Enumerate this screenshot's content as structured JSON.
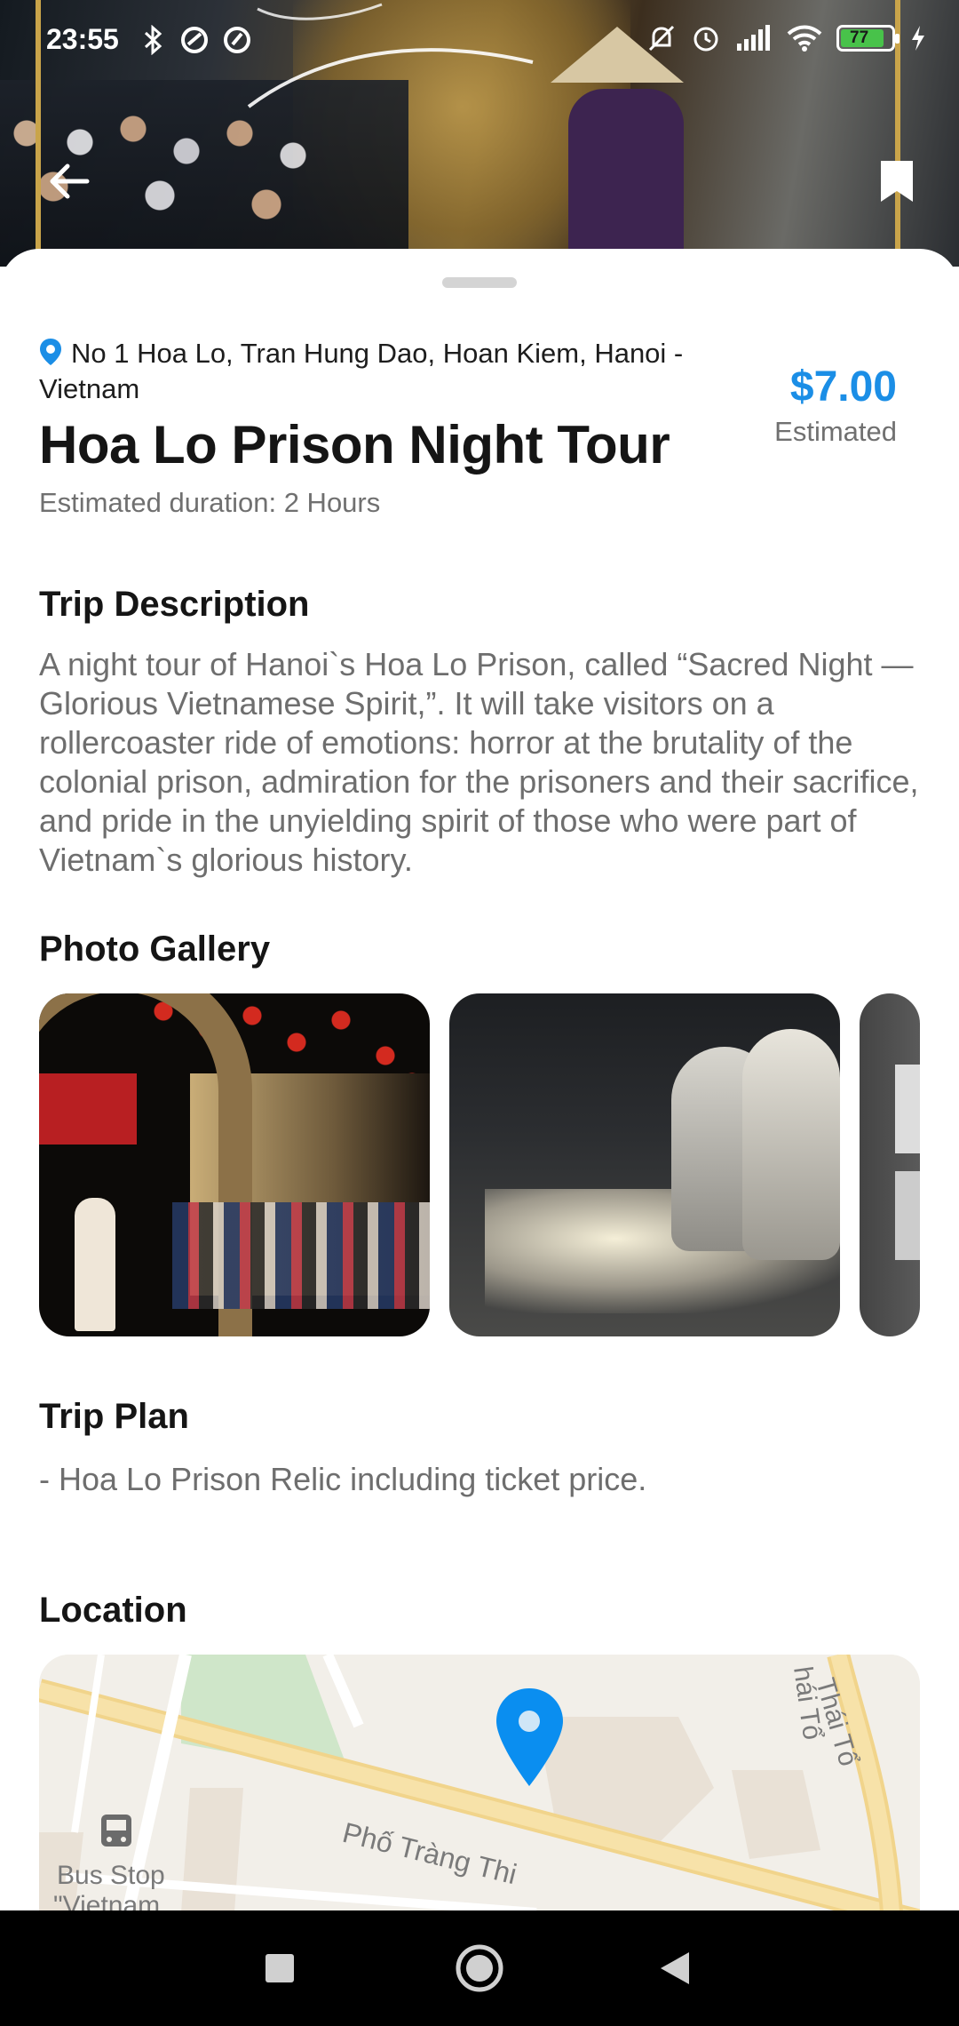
{
  "status_bar": {
    "time": "23:55",
    "battery": "77",
    "icons": [
      "bluetooth-icon",
      "app-icon",
      "app-icon",
      "mute-icon",
      "alarm-icon",
      "signal-icon",
      "wifi-icon",
      "battery-icon",
      "charging-icon"
    ]
  },
  "header": {
    "back_icon": "arrow-left-icon",
    "bookmark_icon": "bookmark-icon"
  },
  "tour": {
    "address": "No 1 Hoa Lo, Tran Hung Dao, Hoan Kiem, Hanoi - Vietnam",
    "title": "Hoa Lo Prison Night Tour",
    "duration": "Estimated duration: 2 Hours",
    "price": "$7.00",
    "price_note": "Estimated"
  },
  "description": {
    "heading": "Trip Description",
    "text": "A night tour of Hanoi`s Hoa Lo Prison, called “Sacred Night — Glorious Vietnamese Spirit,”. It will take visitors on a rollercoaster ride of emotions: horror at the brutality of the colonial prison, admiration for the prisoners and their sacrifice, and pride in the unyielding spirit of those who were part of Vietnam`s glorious history."
  },
  "gallery": {
    "heading": "Photo Gallery",
    "photo_count_visible": 3
  },
  "plan": {
    "heading": "Trip Plan",
    "text": "- Hoa Lo Prison Relic including ticket price."
  },
  "location": {
    "heading": "Location",
    "map_labels": {
      "street_main": "Phố Tràng Thi",
      "street_side": "Thái Tổ",
      "street_side2": "hái Tổ",
      "bus_stop": "Bus Stop",
      "bus_stop2": "\"Vietnam"
    }
  },
  "colors": {
    "accent": "#1b8ee6",
    "map_pin": "#0a8ef0"
  }
}
